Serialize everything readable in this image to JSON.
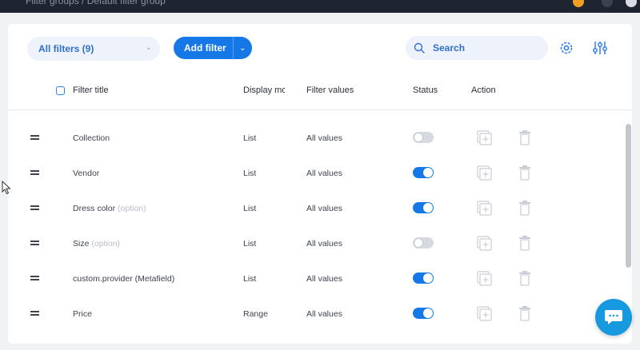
{
  "topbar": {
    "breadcrumb": "Filter groups  /  Default filter group"
  },
  "toolbar": {
    "filters_dropdown": "All filters (9)",
    "add_filter_label": "Add filter",
    "search_placeholder": "Search"
  },
  "table": {
    "headers": {
      "title": "Filter title",
      "display_mode": "Display mo",
      "filter_values": "Filter values",
      "status": "Status",
      "action": "Action"
    },
    "rows": [
      {
        "title": "Collection",
        "suffix": "",
        "display": "List",
        "values": "All values",
        "enabled": false
      },
      {
        "title": "Vendor",
        "suffix": "",
        "display": "List",
        "values": "All values",
        "enabled": true
      },
      {
        "title": "Dress color",
        "suffix": "(option)",
        "display": "List",
        "values": "All values",
        "enabled": true
      },
      {
        "title": "Size",
        "suffix": "(option)",
        "display": "List",
        "values": "All values",
        "enabled": false
      },
      {
        "title": "custom.provider (Metafield)",
        "suffix": "",
        "display": "List",
        "values": "All values",
        "enabled": true
      },
      {
        "title": "Price",
        "suffix": "",
        "display": "Range",
        "values": "All values",
        "enabled": true
      }
    ]
  },
  "colors": {
    "accent": "#1678e6",
    "chat": "#1799e0"
  },
  "icons": [
    "search-icon",
    "gear-icon",
    "sliders-icon",
    "drag-handle-icon",
    "duplicate-icon",
    "trash-icon",
    "chat-icon",
    "chevron-down-icon"
  ]
}
